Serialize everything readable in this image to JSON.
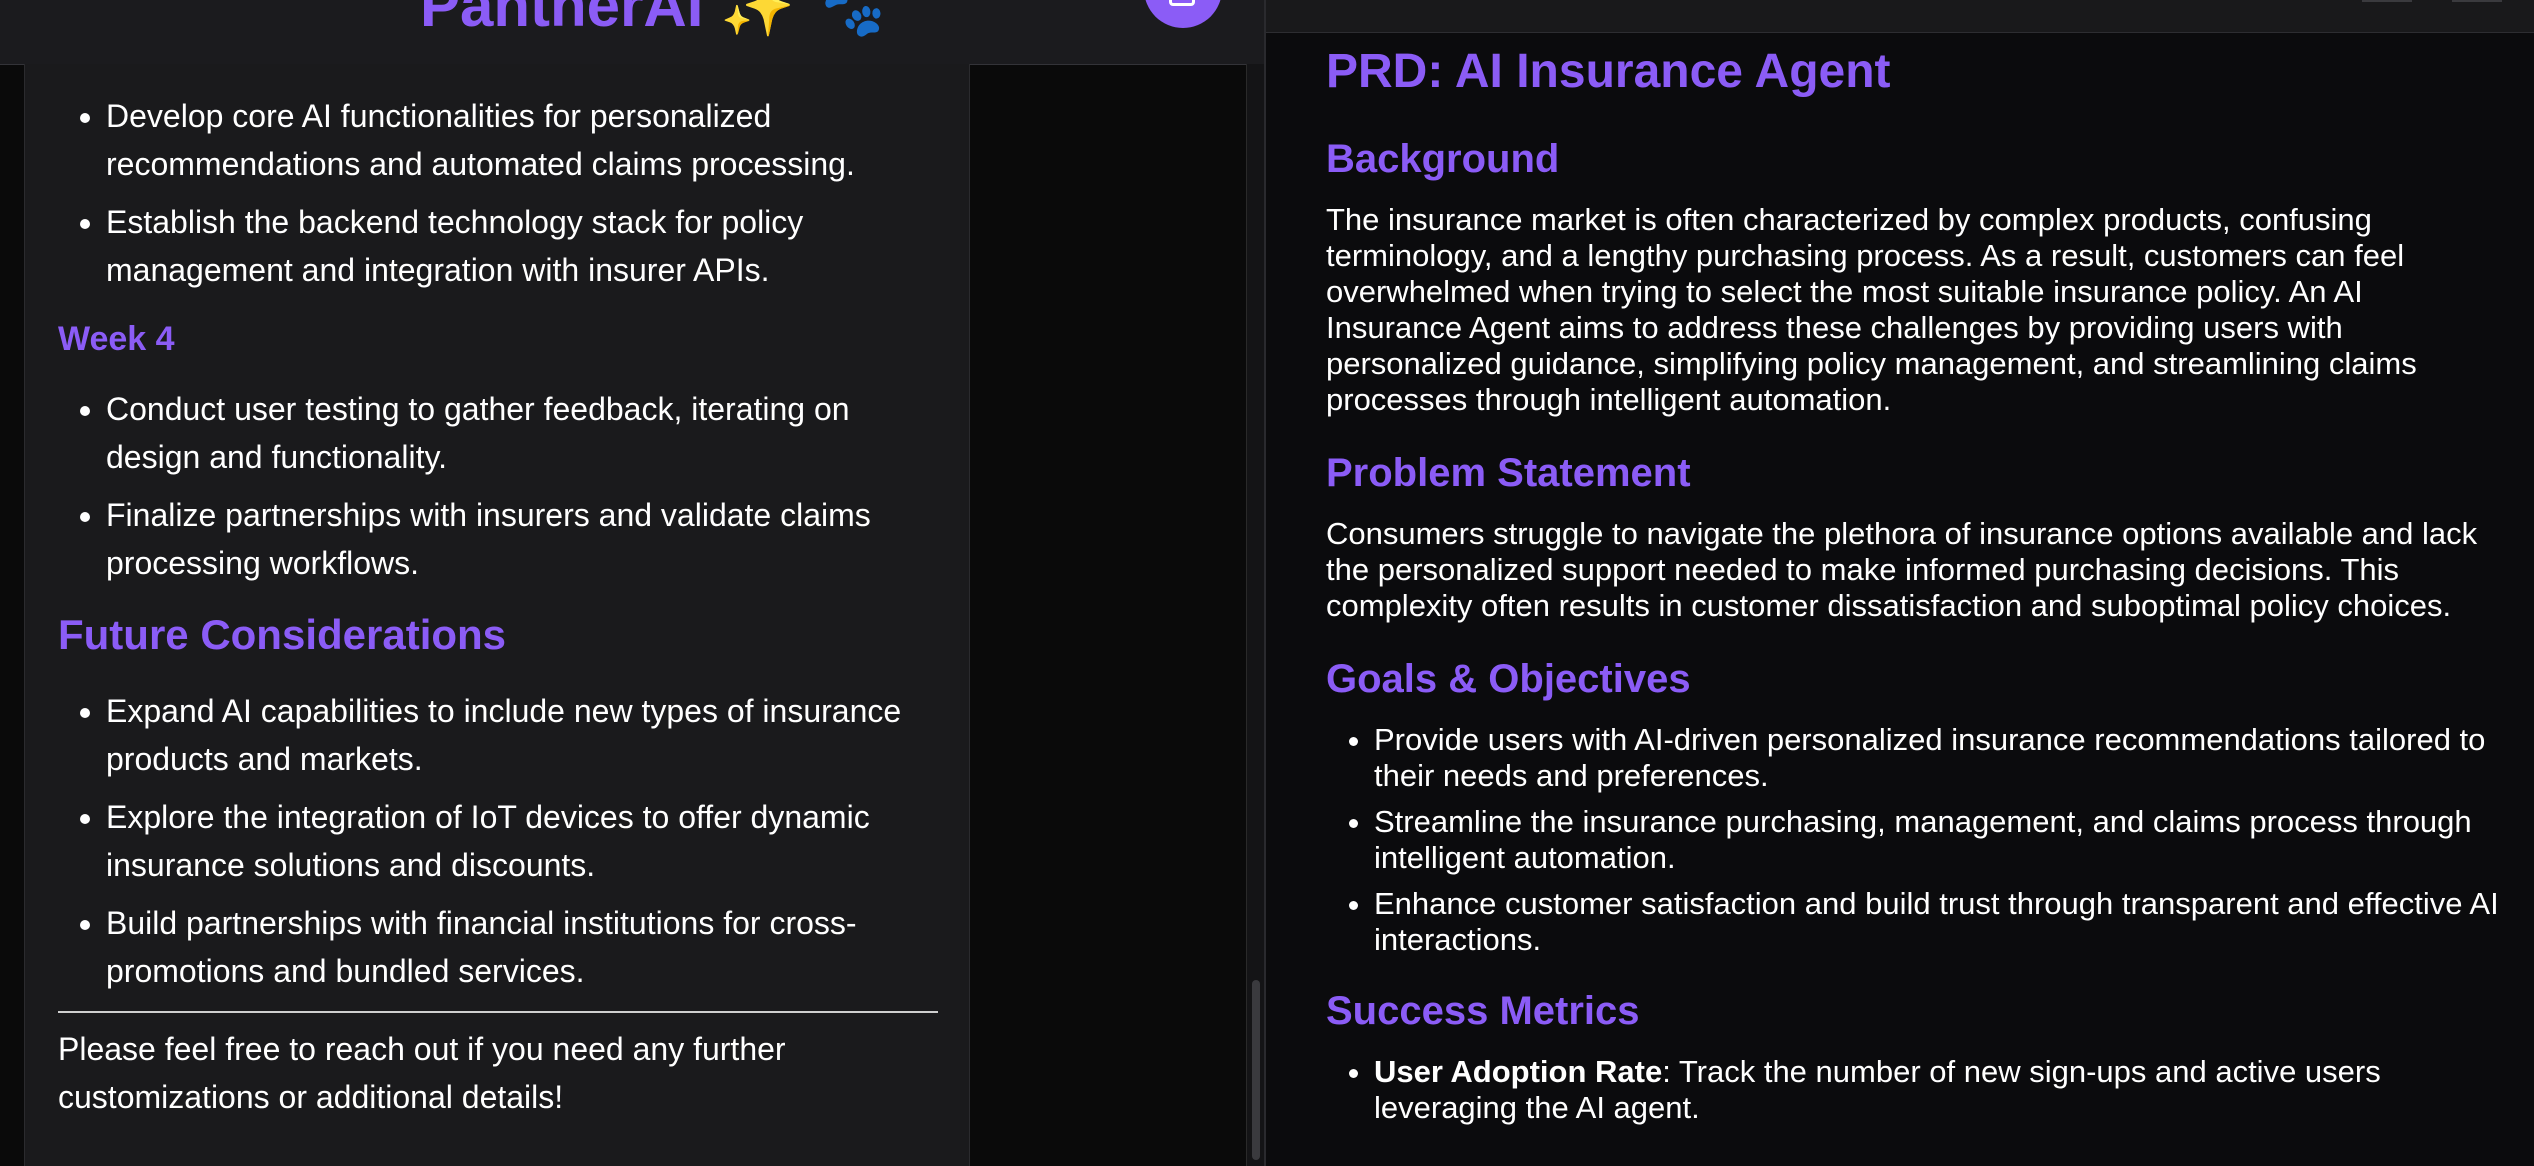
{
  "left": {
    "brand_title": "PantherAI ✨ 🐾",
    "milestones": [
      "Develop core AI functionalities for personalized recommendations and automated claims processing.",
      "Establish the backend technology stack for policy management and integration with insurer APIs."
    ],
    "week4": {
      "heading": "Week 4",
      "items": [
        "Conduct user testing to gather feedback, iterating on design and functionality.",
        "Finalize partnerships with insurers and validate claims processing workflows."
      ]
    },
    "future": {
      "heading": "Future Considerations",
      "items": [
        "Expand AI capabilities to include new types of insurance products and markets.",
        "Explore the integration of IoT devices to offer dynamic insurance solutions and discounts.",
        "Build partnerships with financial institutions for cross-promotions and bundled services."
      ]
    },
    "closing": "Please feel free to reach out if you need any further customizations or additional details!"
  },
  "right": {
    "title": "PRD: AI Insurance Agent",
    "background": {
      "heading": "Background",
      "text": "The insurance market is often characterized by complex products, confusing terminology, and a lengthy purchasing process. As a result, customers can feel overwhelmed when trying to select the most suitable insurance policy. An AI Insurance Agent aims to address these challenges by providing users with personalized guidance, simplifying policy management, and streamlining claims processes through intelligent automation."
    },
    "problem": {
      "heading": "Problem Statement",
      "text": "Consumers struggle to navigate the plethora of insurance options available and lack the personalized support needed to make informed purchasing decisions. This complexity often results in customer dissatisfaction and suboptimal policy choices."
    },
    "goals": {
      "heading": "Goals & Objectives",
      "items": [
        "Provide users with AI-driven personalized insurance recommendations tailored to their needs and preferences.",
        "Streamline the insurance purchasing, management, and claims process through intelligent automation.",
        "Enhance customer satisfaction and build trust through transparent and effective AI interactions."
      ]
    },
    "metrics": {
      "heading": "Success Metrics",
      "item1_label": "User Adoption Rate",
      "item1_text": ": Track the number of new sign-ups and active users leveraging the AI agent."
    }
  },
  "icons": {
    "header_button": "new-chat-icon"
  },
  "colors": {
    "accent": "#8b5cf6",
    "background": "#0b0b0d",
    "card": "#1a1a1c"
  }
}
